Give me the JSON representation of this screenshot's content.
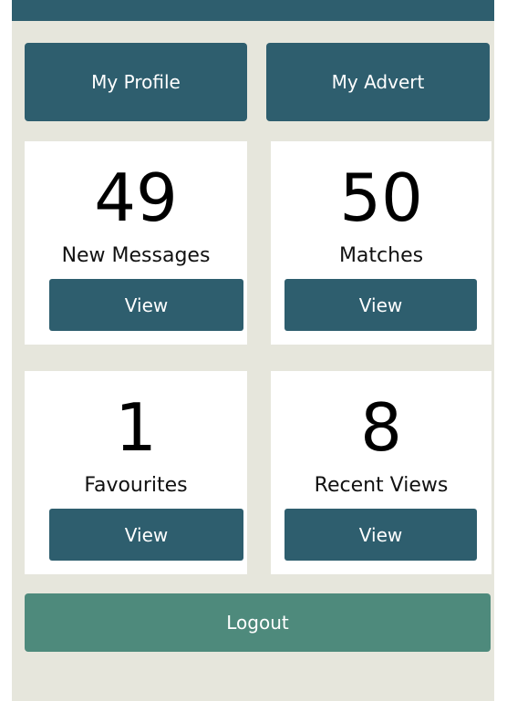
{
  "colors": {
    "primary": "#2e5e6e",
    "logout": "#4e8a7c",
    "background": "#e6e6dc",
    "card": "#ffffff"
  },
  "header": {
    "profile_label": "My Profile",
    "advert_label": "My Advert"
  },
  "stats": [
    {
      "count": "49",
      "label": "New Messages",
      "button": "View"
    },
    {
      "count": "50",
      "label": "Matches",
      "button": "View"
    },
    {
      "count": "1",
      "label": "Favourites",
      "button": "View"
    },
    {
      "count": "8",
      "label": "Recent Views",
      "button": "View"
    }
  ],
  "footer": {
    "logout_label": "Logout"
  }
}
